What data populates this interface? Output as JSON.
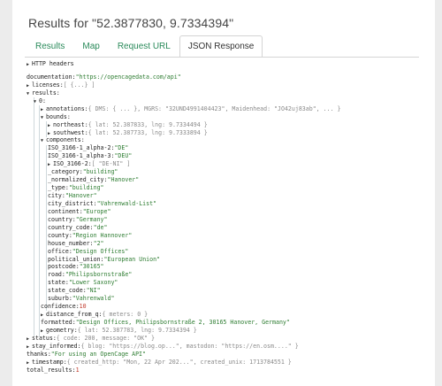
{
  "header": {
    "title": "Results for \"52.3877830, 9.7334394\""
  },
  "tabs": [
    {
      "label": "Results"
    },
    {
      "label": "Map"
    },
    {
      "label": "Request URL"
    },
    {
      "label": "JSON Response",
      "active": true
    }
  ],
  "json": {
    "http_headers": "HTTP headers",
    "documentation_key": "documentation:",
    "documentation_val": "\"https://opencagedata.com/api\"",
    "licenses_key": "licenses:",
    "licenses_val": "[ {...} ]",
    "results_key": "results:",
    "idx0": "0:",
    "annotations_key": "annotations:",
    "annotations_val": "{ DMS: { ... }, MGRS: \"32UND4991404423\", Maidenhead: \"JO42uj83ab\", ... }",
    "bounds_key": "bounds:",
    "northeast_key": "northeast:",
    "northeast_val": "{ lat: 52.387833, lng: 9.7334494 }",
    "southwest_key": "southwest:",
    "southwest_val": "{ lat: 52.387733, lng: 9.7333894 }",
    "components_key": "components:",
    "comp": [
      {
        "k": "ISO_3166-1_alpha-2:",
        "v": "\"DE\""
      },
      {
        "k": "ISO_3166-1_alpha-3:",
        "v": "\"DEU\""
      },
      {
        "k": "ISO_3166-2:",
        "v": "[ \"DE-NI\" ]",
        "arrow": true
      },
      {
        "k": "_category:",
        "v": "\"building\""
      },
      {
        "k": "_normalized_city:",
        "v": "\"Hanover\""
      },
      {
        "k": "_type:",
        "v": "\"building\""
      },
      {
        "k": "city:",
        "v": "\"Hanover\""
      },
      {
        "k": "city_district:",
        "v": "\"Vahrenwald-List\""
      },
      {
        "k": "continent:",
        "v": "\"Europe\""
      },
      {
        "k": "country:",
        "v": "\"Germany\""
      },
      {
        "k": "country_code:",
        "v": "\"de\""
      },
      {
        "k": "county:",
        "v": "\"Region Hannover\""
      },
      {
        "k": "house_number:",
        "v": "\"2\""
      },
      {
        "k": "office:",
        "v": "\"Design Offices\""
      },
      {
        "k": "political_union:",
        "v": "\"European Union\""
      },
      {
        "k": "postcode:",
        "v": "\"30165\""
      },
      {
        "k": "road:",
        "v": "\"Philipsbornstraße\""
      },
      {
        "k": "state:",
        "v": "\"Lower Saxony\""
      },
      {
        "k": "state_code:",
        "v": "\"NI\""
      },
      {
        "k": "suburb:",
        "v": "\"Vahrenwald\""
      }
    ],
    "confidence_key": "confidence:",
    "confidence_val": "10",
    "distance_key": "distance_from_q:",
    "distance_val": "{ meters: 0 }",
    "formatted_key": "formatted:",
    "formatted_val": "\"Design Offices, Philipsbornstraße 2, 30165 Hanover, Germany\"",
    "geometry_key": "geometry:",
    "geometry_val": "{ lat: 52.387783, lng: 9.7334394 }",
    "status_key": "status:",
    "status_val": "{ code: 200, message: \"OK\" }",
    "stay_key": "stay_informed:",
    "stay_val": "{ blog: \"https://blog.op...\", mastodon: \"https://en.osm....\" }",
    "thanks_key": "thanks:",
    "thanks_val": "\"For using an OpenCage API\"",
    "timestamp_key": "timestamp:",
    "timestamp_val": "{ created_http: \"Mon, 22 Apr 202...\", created_unix: 1713784551 }",
    "total_key": "total_results:",
    "total_val": "1"
  }
}
